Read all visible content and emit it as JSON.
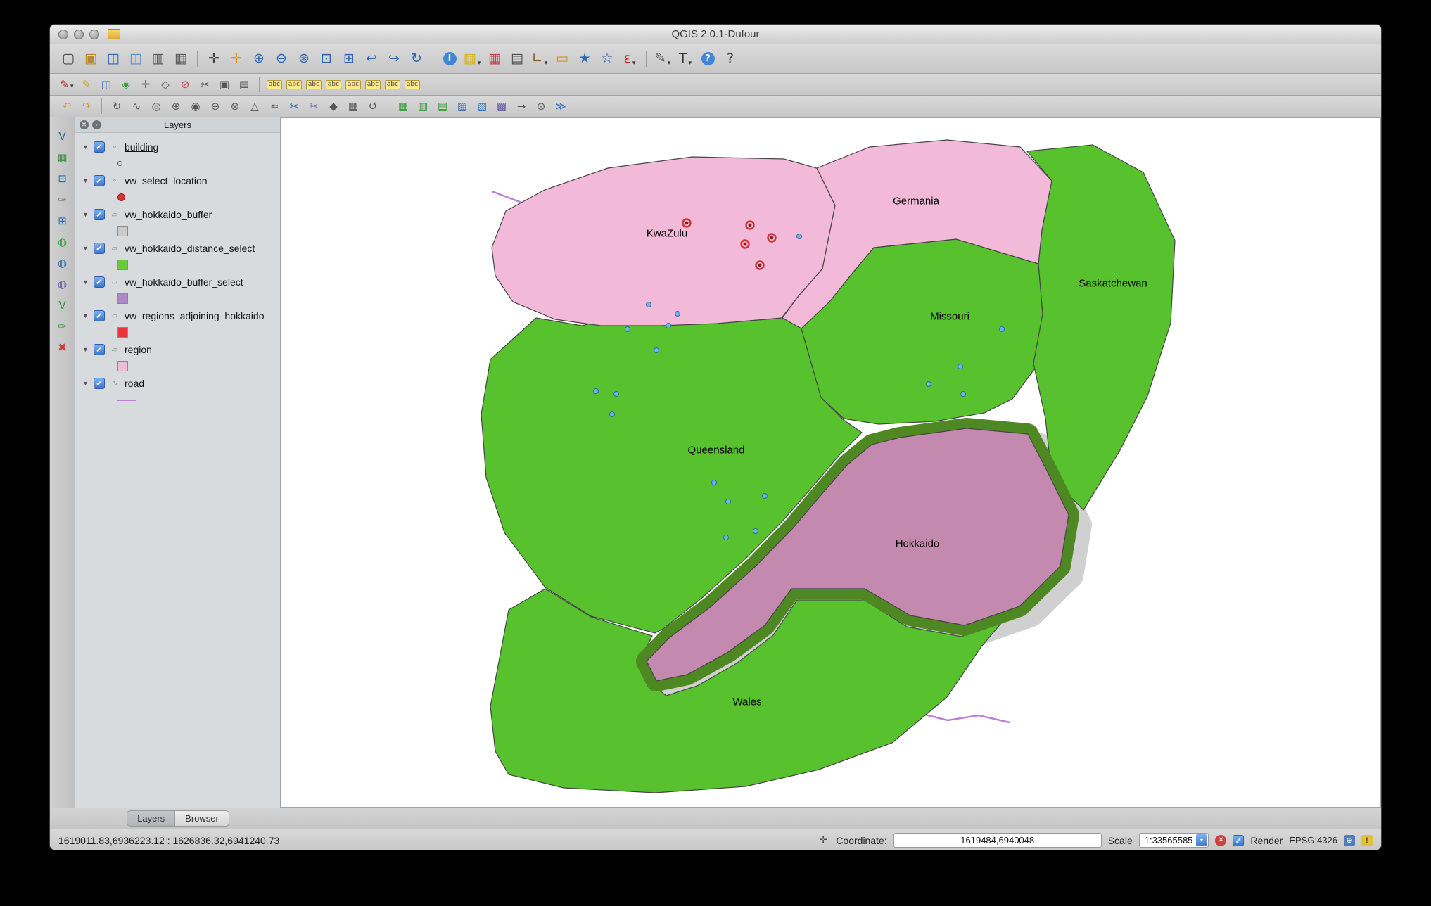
{
  "window": {
    "title": "QGIS 2.0.1-Dufour"
  },
  "toolbars": {
    "row1": [
      {
        "name": "file-new-icon",
        "glyph": "▢",
        "color": "#4a4a4a"
      },
      {
        "name": "file-open-icon",
        "glyph": "▣",
        "color": "#b8862c"
      },
      {
        "name": "save-project-icon",
        "glyph": "◫",
        "color": "#2e66b0"
      },
      {
        "name": "save-project-as-icon",
        "glyph": "◫",
        "color": "#5a8ed0"
      },
      {
        "name": "new-composer-icon",
        "glyph": "▥",
        "color": "#5a5a5a"
      },
      {
        "name": "composer-manager-icon",
        "glyph": "▦",
        "color": "#5a5a5a"
      },
      {
        "sep": true
      },
      {
        "name": "pan-map-icon",
        "glyph": "✛",
        "color": "#444444"
      },
      {
        "name": "pan-to-selection-icon",
        "glyph": "✛",
        "color": "#d49a1c"
      },
      {
        "name": "zoom-in-icon",
        "glyph": "⊕",
        "color": "#2e66b0"
      },
      {
        "name": "zoom-out-icon",
        "glyph": "⊖",
        "color": "#2e66b0"
      },
      {
        "name": "zoom-full-icon",
        "glyph": "⊛",
        "color": "#2e66b0"
      },
      {
        "name": "zoom-to-selection-icon",
        "glyph": "⊡",
        "color": "#2e66b0"
      },
      {
        "name": "zoom-to-layer-icon",
        "glyph": "⊞",
        "color": "#2e66b0"
      },
      {
        "name": "zoom-last-icon",
        "glyph": "↩",
        "color": "#2e66b0"
      },
      {
        "name": "zoom-next-icon",
        "glyph": "↪",
        "color": "#2e66b0"
      },
      {
        "name": "refresh-icon",
        "glyph": "↻",
        "color": "#2e66b0"
      },
      {
        "sep": true
      },
      {
        "name": "identify-icon",
        "glyph": "i",
        "badge": "#3f87d6"
      },
      {
        "name": "select-features-icon",
        "glyph": "▦",
        "color": "#d8b21a",
        "dropdown": true
      },
      {
        "name": "deselect-features-icon",
        "glyph": "▦",
        "color": "#cc3b3b"
      },
      {
        "name": "attribute-table-icon",
        "glyph": "▤",
        "color": "#4a4a4a"
      },
      {
        "name": "measure-icon",
        "glyph": "∟",
        "color": "#8a5a2a",
        "dropdown": true
      },
      {
        "name": "map-tips-icon",
        "glyph": "▭",
        "color": "#c7931c"
      },
      {
        "name": "new-bookmark-icon",
        "glyph": "★",
        "color": "#2e66b0"
      },
      {
        "name": "show-bookmarks-icon",
        "glyph": "☆",
        "color": "#2e66b0"
      },
      {
        "name": "labeling-expression-icon",
        "glyph": "ε",
        "color": "#cc2222",
        "dropdown": true
      },
      {
        "sep": true
      },
      {
        "name": "annotation-icon",
        "glyph": "✎",
        "color": "#555555",
        "dropdown": true
      },
      {
        "name": "text-annotation-icon",
        "glyph": "T",
        "color": "#333333",
        "dropdown": true
      },
      {
        "name": "help-icon",
        "glyph": "?",
        "badge": "#3f87d6"
      },
      {
        "name": "whats-this-icon",
        "glyph": "?",
        "color": "#333333"
      }
    ],
    "row2": [
      {
        "name": "current-edits-icon",
        "glyph": "✎",
        "color": "#b22222",
        "dropdown": true
      },
      {
        "name": "toggle-editing-icon",
        "glyph": "✎",
        "color": "#d2a21a"
      },
      {
        "name": "save-layer-edits-icon",
        "glyph": "◫",
        "color": "#2e66b0"
      },
      {
        "name": "add-feature-icon",
        "glyph": "◈",
        "color": "#2f9e2f"
      },
      {
        "name": "move-feature-icon",
        "glyph": "✛",
        "color": "#555555"
      },
      {
        "name": "node-tool-icon",
        "glyph": "◇",
        "color": "#555555"
      },
      {
        "name": "delete-selected-icon",
        "glyph": "⊘",
        "color": "#cc3b3b"
      },
      {
        "name": "cut-features-icon",
        "glyph": "✂",
        "color": "#555555"
      },
      {
        "name": "copy-features-icon",
        "glyph": "▣",
        "color": "#555555"
      },
      {
        "name": "paste-features-icon",
        "glyph": "▤",
        "color": "#555555"
      },
      {
        "sep": true
      },
      {
        "name": "labeling-icon",
        "abc": true
      },
      {
        "name": "label-move-icon",
        "abc": true
      },
      {
        "name": "label-rotate-icon",
        "abc": true
      },
      {
        "name": "label-pin-icon",
        "abc": true
      },
      {
        "name": "label-show-hide-icon",
        "abc": true
      },
      {
        "name": "label-change-icon",
        "abc": true
      },
      {
        "name": "label-preferences-icon",
        "abc": true
      },
      {
        "name": "label-properties-icon",
        "abc": true
      }
    ],
    "row3": [
      {
        "name": "undo-icon",
        "glyph": "↶",
        "color": "#d2a21a"
      },
      {
        "name": "redo-icon",
        "glyph": "↷",
        "color": "#d2a21a"
      },
      {
        "sep": true
      },
      {
        "name": "rotate-feature-icon",
        "glyph": "↻",
        "color": "#555555"
      },
      {
        "name": "simplify-feature-icon",
        "glyph": "∿",
        "color": "#555555"
      },
      {
        "name": "add-ring-icon",
        "glyph": "◎",
        "color": "#555555"
      },
      {
        "name": "add-part-icon",
        "glyph": "⊕",
        "color": "#555555"
      },
      {
        "name": "fill-ring-icon",
        "glyph": "◉",
        "color": "#555555"
      },
      {
        "name": "delete-ring-icon",
        "glyph": "⊖",
        "color": "#555555"
      },
      {
        "name": "delete-part-icon",
        "glyph": "⊗",
        "color": "#555555"
      },
      {
        "name": "reshape-features-icon",
        "glyph": "△",
        "color": "#555555"
      },
      {
        "name": "offset-curve-icon",
        "glyph": "≈",
        "color": "#555555"
      },
      {
        "name": "split-features-icon",
        "glyph": "✂",
        "color": "#2e66b0"
      },
      {
        "name": "split-parts-icon",
        "glyph": "✂",
        "color": "#7a6ac0"
      },
      {
        "name": "merge-features-icon",
        "glyph": "◆",
        "color": "#555555"
      },
      {
        "name": "merge-attributes-icon",
        "glyph": "▦",
        "color": "#555555"
      },
      {
        "name": "rotate-point-symbols-icon",
        "glyph": "↺",
        "color": "#555555"
      },
      {
        "sep": true
      },
      {
        "name": "raster-stretch-icon",
        "glyph": "▦",
        "color": "#2f9e2f"
      },
      {
        "name": "raster-histogram-icon",
        "glyph": "▥",
        "color": "#2f9e2f"
      },
      {
        "name": "local-histogram-stretch-icon",
        "glyph": "▤",
        "color": "#2f9e2f"
      },
      {
        "name": "heatmap-icon",
        "glyph": "▨",
        "color": "#2e66b0"
      },
      {
        "name": "interpolation-icon",
        "glyph": "▧",
        "color": "#2e66b0"
      },
      {
        "name": "terrain-analysis-icon",
        "glyph": "▩",
        "color": "#6a5aad"
      },
      {
        "name": "road-graph-icon",
        "glyph": "→",
        "color": "#555555"
      },
      {
        "name": "spatial-query-icon",
        "glyph": "⊙",
        "color": "#555555"
      },
      {
        "name": "python-console-icon",
        "glyph": "≫",
        "color": "#2e66b0"
      }
    ],
    "left": [
      {
        "name": "add-vector-layer-icon",
        "glyph": "V",
        "color": "#2b5fb0"
      },
      {
        "name": "add-raster-layer-icon",
        "glyph": "▦",
        "color": "#3f8f3f"
      },
      {
        "name": "add-postgis-layer-icon",
        "glyph": "⊟",
        "color": "#2e66b0"
      },
      {
        "name": "add-spatialite-layer-icon",
        "glyph": "✑",
        "color": "#777777"
      },
      {
        "name": "add-mssql-layer-icon",
        "glyph": "⊞",
        "color": "#2e66b0"
      },
      {
        "name": "add-wms-layer-icon",
        "glyph": "◍",
        "color": "#2f9e2f"
      },
      {
        "name": "add-wcs-layer-icon",
        "glyph": "◍",
        "color": "#2e66b0"
      },
      {
        "name": "add-wfs-layer-icon",
        "glyph": "◍",
        "color": "#6a5aad"
      },
      {
        "name": "new-shapefile-layer-icon",
        "glyph": "V",
        "color": "#2f9e2f"
      },
      {
        "name": "new-spatialite-layer-icon",
        "glyph": "✑",
        "color": "#2f9e2f"
      },
      {
        "name": "remove-layer-icon",
        "glyph": "✖",
        "color": "#cc3b3b"
      }
    ]
  },
  "layers_panel": {
    "header": "Layers",
    "tabs": [
      "Layers",
      "Browser"
    ],
    "layers": [
      {
        "name": "building",
        "kind": "point",
        "symbol": "point_small",
        "symbol_color": "#d8d8d8",
        "checked": true,
        "selected": true
      },
      {
        "name": "vw_select_location",
        "kind": "point",
        "symbol": "point_red",
        "symbol_color": "#e03030",
        "checked": true
      },
      {
        "name": "vw_hokkaido_buffer",
        "kind": "polygon",
        "symbol": "square",
        "symbol_color": "#cbcbcb",
        "checked": true
      },
      {
        "name": "vw_hokkaido_distance_select",
        "kind": "polygon",
        "symbol": "square",
        "symbol_color": "#67ce3a",
        "checked": true
      },
      {
        "name": "vw_hokkaido_buffer_select",
        "kind": "polygon",
        "symbol": "square",
        "symbol_color": "#b286c9",
        "checked": true
      },
      {
        "name": "vw_regions_adjoining_hokkaido",
        "kind": "polygon",
        "symbol": "square",
        "symbol_color": "#e8353a",
        "checked": true
      },
      {
        "name": "region",
        "kind": "polygon",
        "symbol": "square",
        "symbol_color": "#f4bada",
        "checked": true
      },
      {
        "name": "road",
        "kind": "line",
        "symbol": "line",
        "symbol_color": "#b97fd9",
        "checked": true
      }
    ]
  },
  "map": {
    "labels": [
      {
        "text": "KwaZulu"
      },
      {
        "text": "Germania"
      },
      {
        "text": "Missouri"
      },
      {
        "text": "Saskatchewan"
      },
      {
        "text": "Queensland"
      },
      {
        "text": "Hokkaido"
      },
      {
        "text": "Wales"
      }
    ],
    "colors": {
      "green": "#58c22e",
      "pink": "#f2b9d9",
      "mauve": "#c489ae",
      "buffer": "#4e8822",
      "shadow": "#aaaaaa",
      "road": "#b97fd9",
      "point": "#73b2e6",
      "point_stroke": "#2d6da8",
      "selected_ring": "#d03030",
      "selected_point": "#7a2020",
      "border": "#454545"
    }
  },
  "status_bar": {
    "extent": "1619011.83,6936223.12 : 1626836.32,6941240.73",
    "coordinate_label": "Coordinate:",
    "coordinate_value": "1619484,6940048",
    "scale_label": "Scale",
    "scale_value": "1:33565585",
    "render_label": "Render",
    "epsg": "EPSG:4326"
  }
}
